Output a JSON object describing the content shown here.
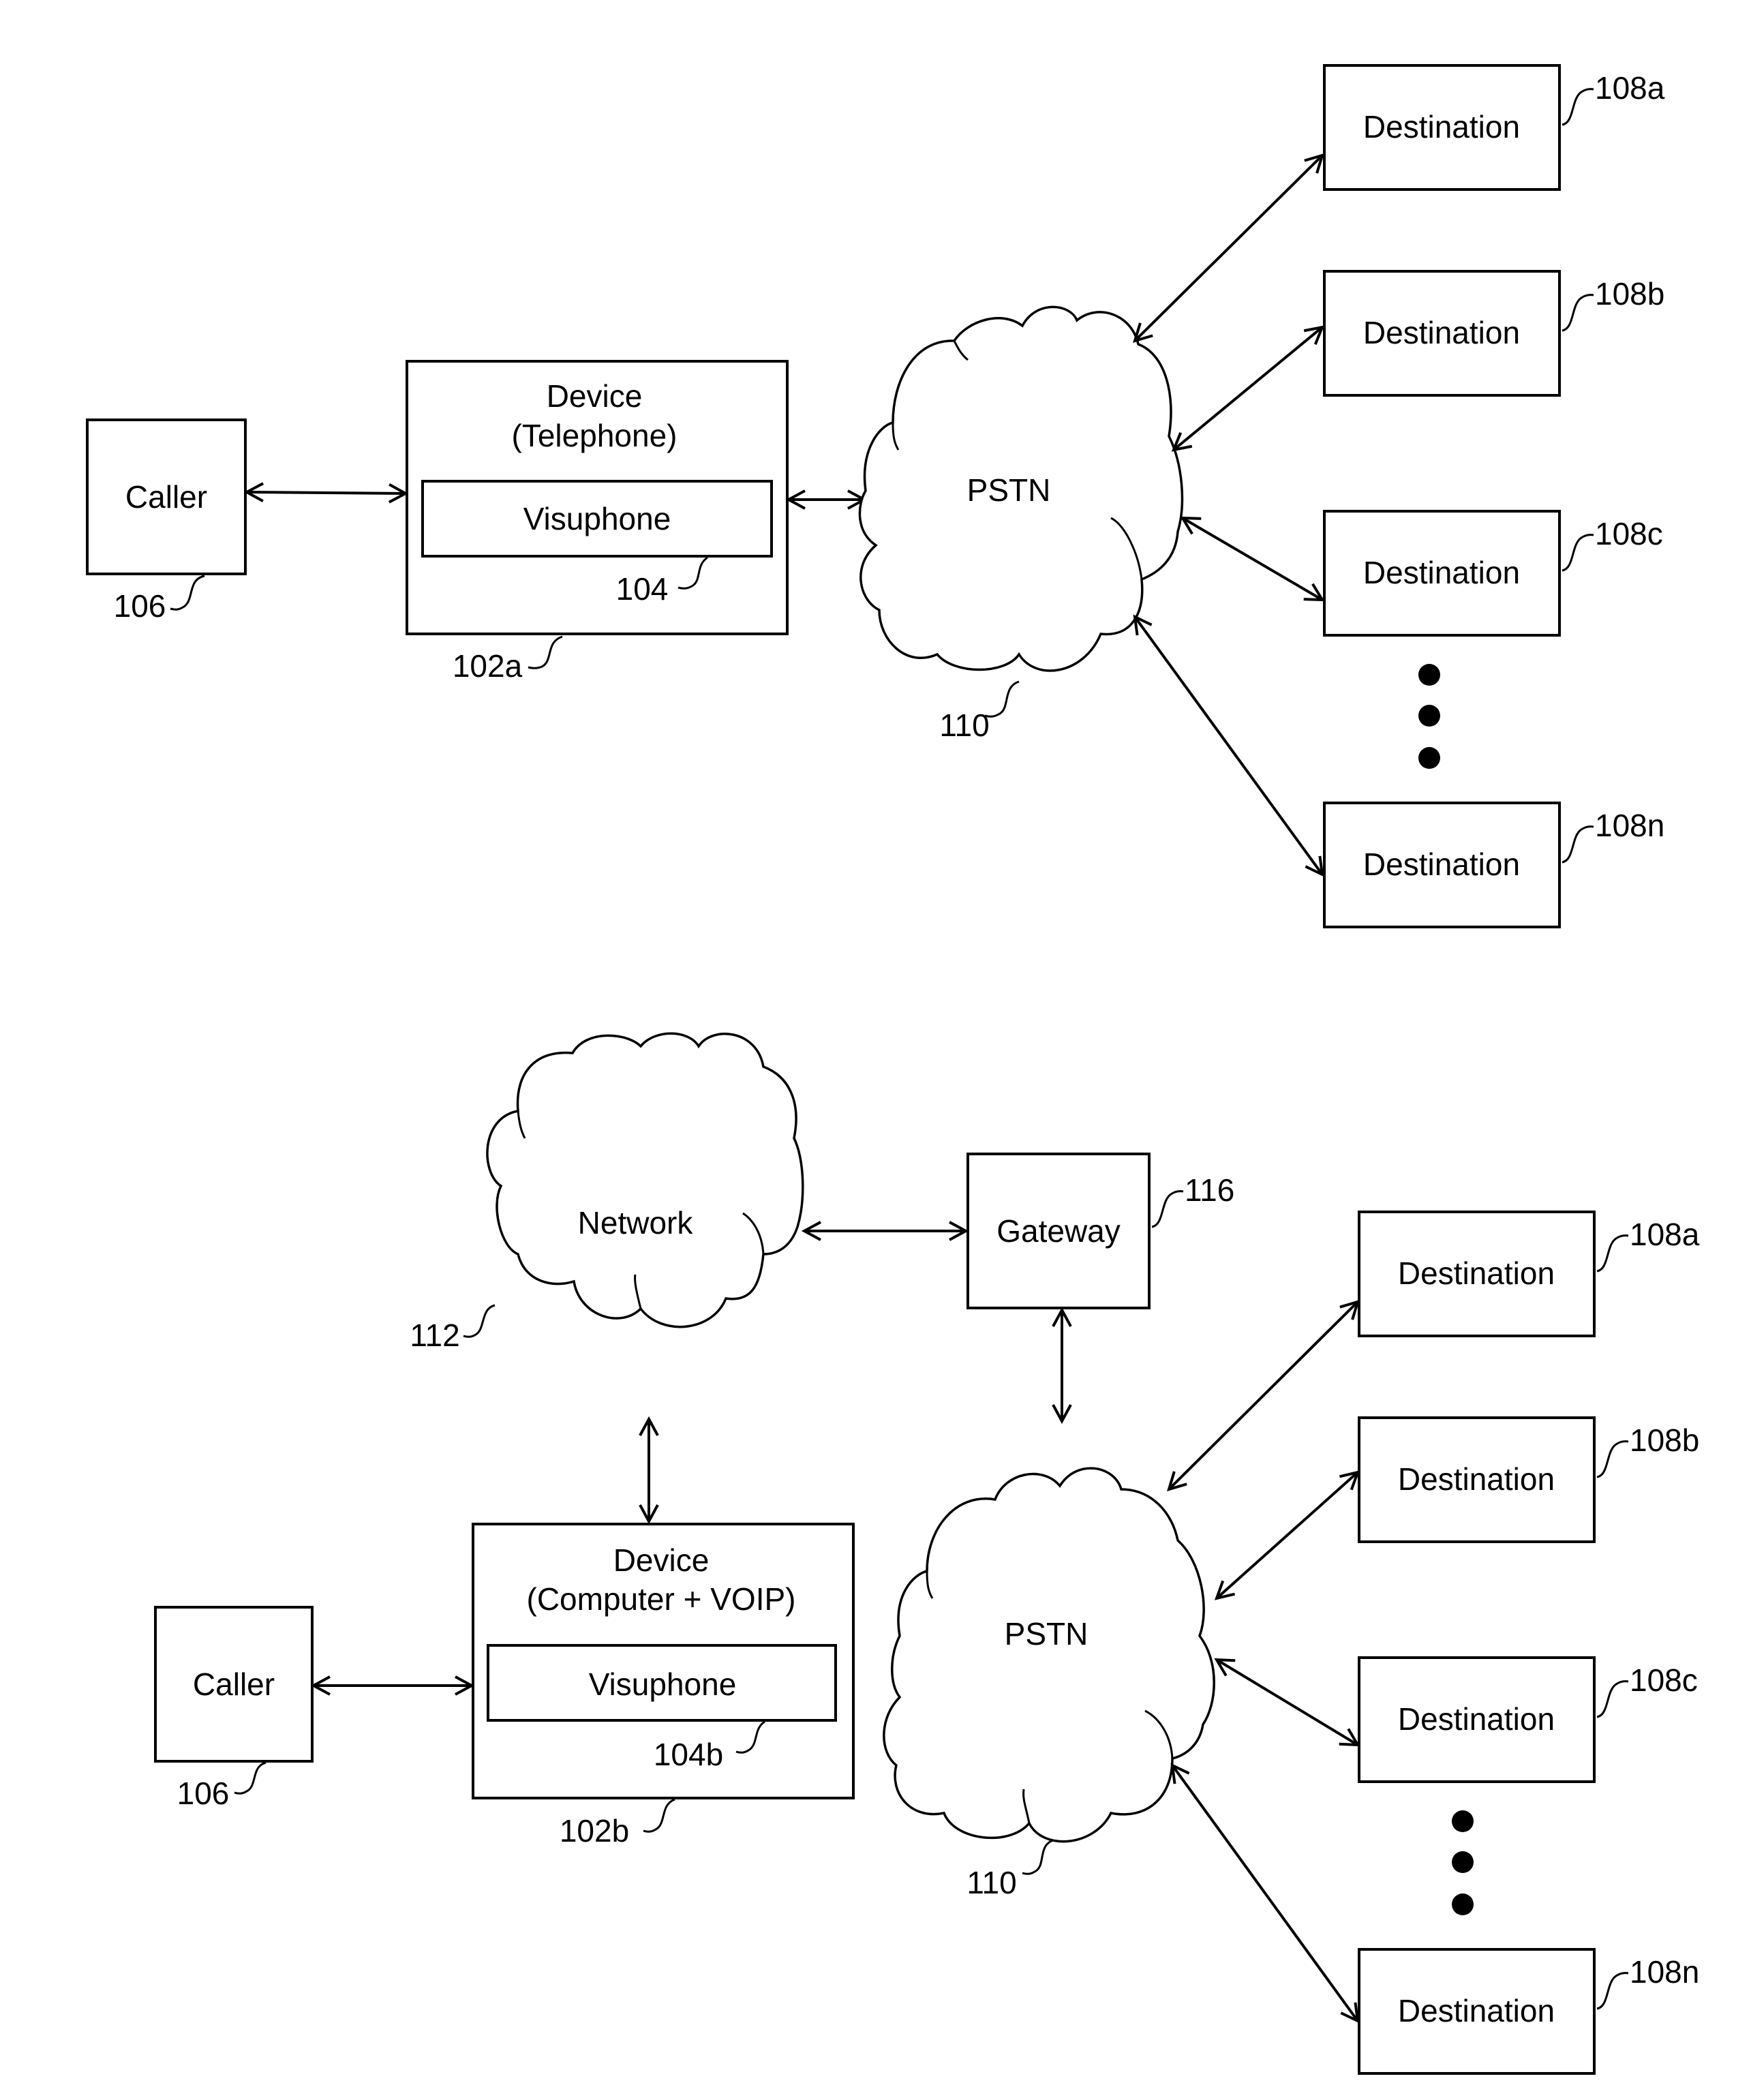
{
  "figure_top": {
    "caller": {
      "label": "Caller",
      "ref": "106"
    },
    "device": {
      "label_line1": "Device",
      "label_line2": "(Telephone)",
      "ref": "102a"
    },
    "visuphone": {
      "label": "Visuphone",
      "ref": "104"
    },
    "pstn": {
      "label": "PSTN",
      "ref": "110"
    },
    "destinations": [
      {
        "label": "Destination",
        "ref": "108a"
      },
      {
        "label": "Destination",
        "ref": "108b"
      },
      {
        "label": "Destination",
        "ref": "108c"
      },
      {
        "label": "Destination",
        "ref": "108n"
      }
    ]
  },
  "figure_bottom": {
    "caller": {
      "label": "Caller",
      "ref": "106"
    },
    "device": {
      "label_line1": "Device",
      "label_line2": "(Computer + VOIP)",
      "ref": "102b"
    },
    "visuphone": {
      "label": "Visuphone",
      "ref": "104b"
    },
    "network": {
      "label": "Network",
      "ref": "112"
    },
    "gateway": {
      "label": "Gateway",
      "ref": "116"
    },
    "pstn": {
      "label": "PSTN",
      "ref": "110"
    },
    "destinations": [
      {
        "label": "Destination",
        "ref": "108a"
      },
      {
        "label": "Destination",
        "ref": "108b"
      },
      {
        "label": "Destination",
        "ref": "108c"
      },
      {
        "label": "Destination",
        "ref": "108n"
      }
    ]
  }
}
